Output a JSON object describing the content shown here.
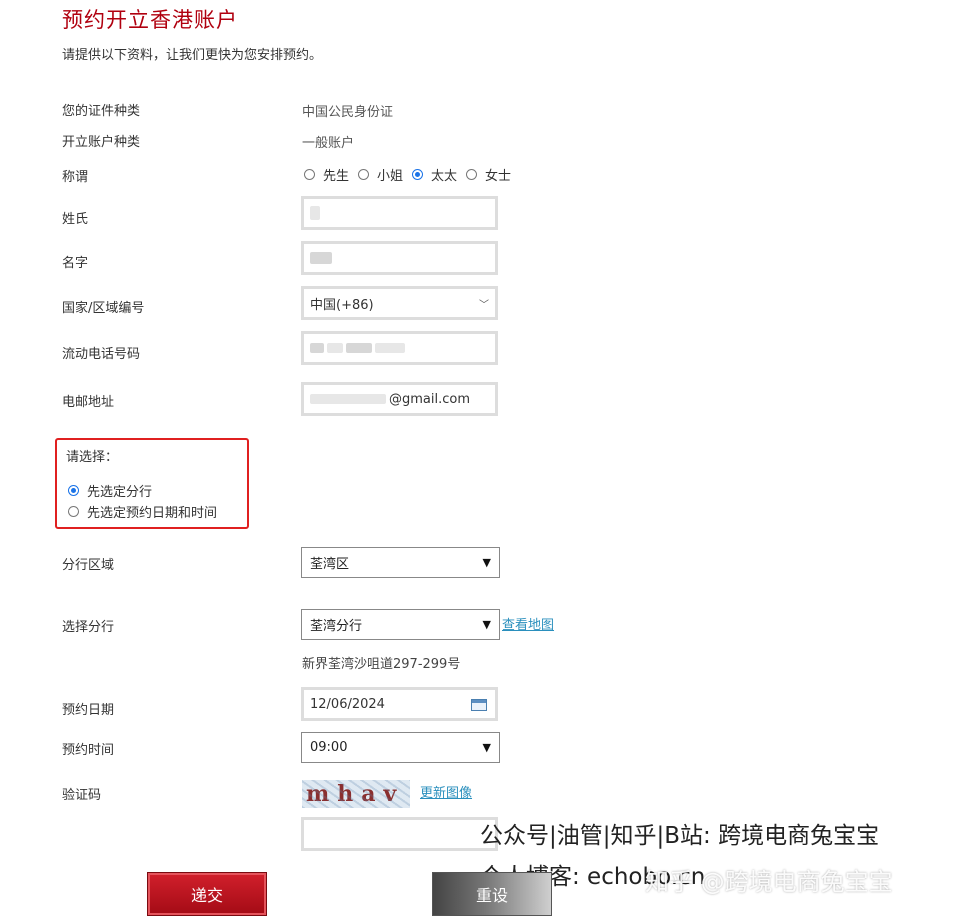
{
  "header": {
    "title": "预约开立香港账户",
    "subtitle": "请提供以下资料，让我们更快为您安排预约。"
  },
  "form": {
    "id_type": {
      "label": "您的证件种类",
      "value": "中国公民身份证"
    },
    "account_type": {
      "label": "开立账户种类",
      "value": "一般账户"
    },
    "salutation": {
      "label": "称谓",
      "options": [
        "先生",
        "小姐",
        "太太",
        "女士"
      ],
      "selected": "太太"
    },
    "surname": {
      "label": "姓氏"
    },
    "given_name": {
      "label": "名字"
    },
    "country_code": {
      "label": "国家/区域编号",
      "value": "中国(+86)"
    },
    "mobile": {
      "label": "流动电话号码"
    },
    "email": {
      "label": "电邮地址",
      "value_suffix": "@gmail.com"
    },
    "choose": {
      "title": "请选择：",
      "options": [
        "先选定分行",
        "先选定预约日期和时间"
      ],
      "selected": "先选定分行"
    },
    "branch_region": {
      "label": "分行区域",
      "value": "荃湾区"
    },
    "branch": {
      "label": "选择分行",
      "value": "荃湾分行",
      "map_link": "查看地图",
      "address": "新界荃湾沙咀道297-299号"
    },
    "date": {
      "label": "预约日期",
      "value": "12/06/2024"
    },
    "time": {
      "label": "预约时间",
      "value": "09:00"
    },
    "captcha": {
      "label": "验证码",
      "text": "mhav",
      "refresh_link": "更新图像"
    }
  },
  "buttons": {
    "submit": "递交",
    "reset": "重设"
  },
  "watermark": {
    "line1": "公众号|油管|知乎|B站: 跨境电商兔宝宝",
    "line2": "个人博客: echobo.cn",
    "overlay": "知乎 @跨境电商兔宝宝"
  },
  "colors": {
    "brand_red": "#b0000f",
    "highlight_box": "#e02020",
    "link": "#2a8fbd",
    "radio_on": "#1a73e8"
  }
}
